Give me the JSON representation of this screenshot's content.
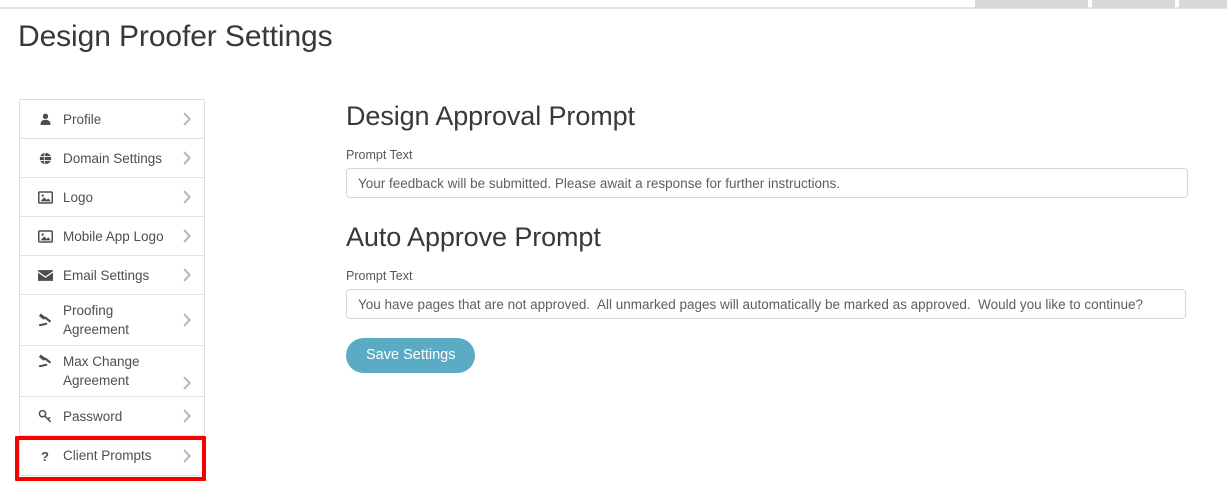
{
  "page": {
    "title": "Design Proofer Settings"
  },
  "sidebar": {
    "items": [
      {
        "label": "Profile",
        "icon": "user-icon",
        "chevron": "chevron-right-icon"
      },
      {
        "label": "Domain Settings",
        "icon": "globe-icon",
        "chevron": "chevron-right-icon"
      },
      {
        "label": "Logo",
        "icon": "image-icon",
        "chevron": "chevron-right-icon"
      },
      {
        "label": "Mobile App Logo",
        "icon": "image-icon",
        "chevron": "chevron-right-icon"
      },
      {
        "label": "Email Settings",
        "icon": "envelope-icon",
        "chevron": "chevron-right-icon"
      },
      {
        "label": "Proofing Agreement",
        "icon": "gavel-icon",
        "chevron": "chevron-right-icon"
      },
      {
        "label": "Max Change Agreement",
        "icon": "gavel-icon",
        "chevron": "chevron-right-icon"
      },
      {
        "label": "Password",
        "icon": "key-icon",
        "chevron": "chevron-right-icon"
      },
      {
        "label": "Client Prompts",
        "icon": "question-icon",
        "chevron": "chevron-right-icon"
      }
    ],
    "highlighted_item": "Client Prompts",
    "highlight_color": "#f70000"
  },
  "main": {
    "design_approval": {
      "heading": "Design Approval Prompt",
      "field_label": "Prompt Text",
      "value": "Your feedback will be submitted. Please await a response for further instructions.",
      "placeholder": ""
    },
    "auto_approve": {
      "heading": "Auto Approve Prompt",
      "field_label": "Prompt Text",
      "value": "You have pages that are not approved.  All unmarked pages will automatically be marked as approved.  Would you like to continue?",
      "placeholder": ""
    },
    "save_label": "Save Settings",
    "save_color": "#5aabc3"
  }
}
